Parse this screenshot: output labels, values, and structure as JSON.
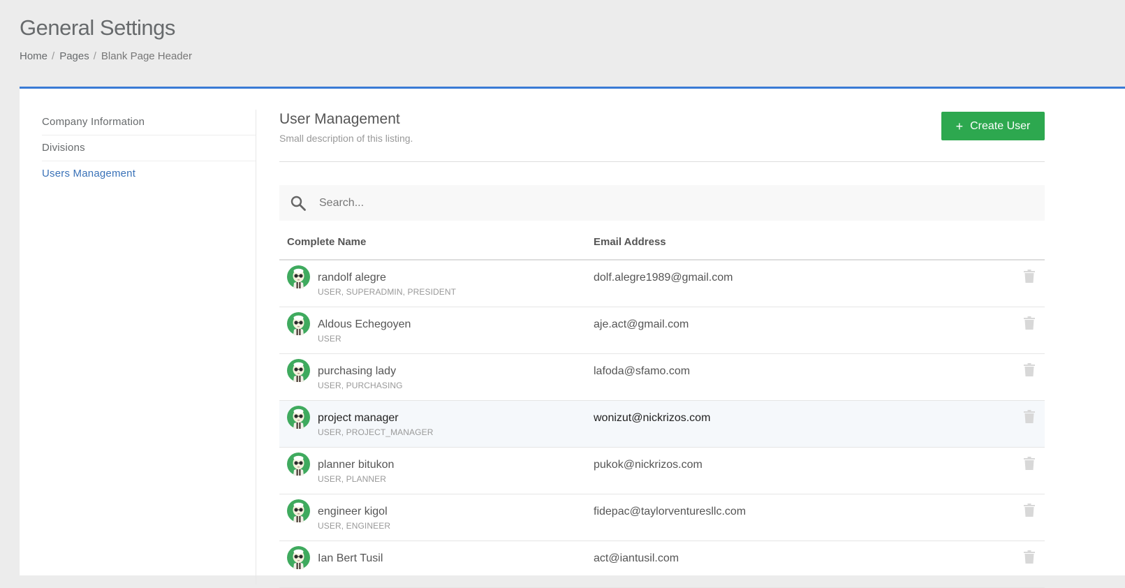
{
  "header": {
    "title": "General Settings",
    "breadcrumb": [
      "Home",
      "Pages",
      "Blank Page Header"
    ]
  },
  "sidebar": {
    "items": [
      {
        "label": "Company Information",
        "active": false
      },
      {
        "label": "Divisions",
        "active": false
      },
      {
        "label": "Users Management",
        "active": true
      }
    ]
  },
  "main": {
    "title": "User Management",
    "description": "Small description of this listing.",
    "create_button": {
      "icon": "plus-icon",
      "label": "Create User"
    },
    "search": {
      "placeholder": "Search...",
      "value": "",
      "icon": "search-icon"
    },
    "table": {
      "headers": [
        "Complete Name",
        "Email Address"
      ],
      "rows": [
        {
          "name": "randolf alegre",
          "roles": "USER, SUPERADMIN, PRESIDENT",
          "email": "dolf.alegre1989@gmail.com"
        },
        {
          "name": "Aldous Echegoyen",
          "roles": "USER",
          "email": "aje.act@gmail.com"
        },
        {
          "name": "purchasing lady",
          "roles": "USER, PURCHASING",
          "email": "lafoda@sfamo.com"
        },
        {
          "name": "project manager",
          "roles": "USER, PROJECT_MANAGER",
          "email": "wonizut@nickrizos.com"
        },
        {
          "name": "planner bitukon",
          "roles": "USER, PLANNER",
          "email": "pukok@nickrizos.com"
        },
        {
          "name": "engineer kigol",
          "roles": "USER, ENGINEER",
          "email": "fidepac@taylorventuresllc.com"
        },
        {
          "name": "Ian Bert Tusil",
          "roles": "",
          "email": "act@iantusil.com"
        }
      ]
    }
  },
  "colors": {
    "accent": "#3a7bd5",
    "create_button": "#2da84f",
    "active_link": "#3a72b8",
    "avatar_ring": "#3faa5e"
  }
}
